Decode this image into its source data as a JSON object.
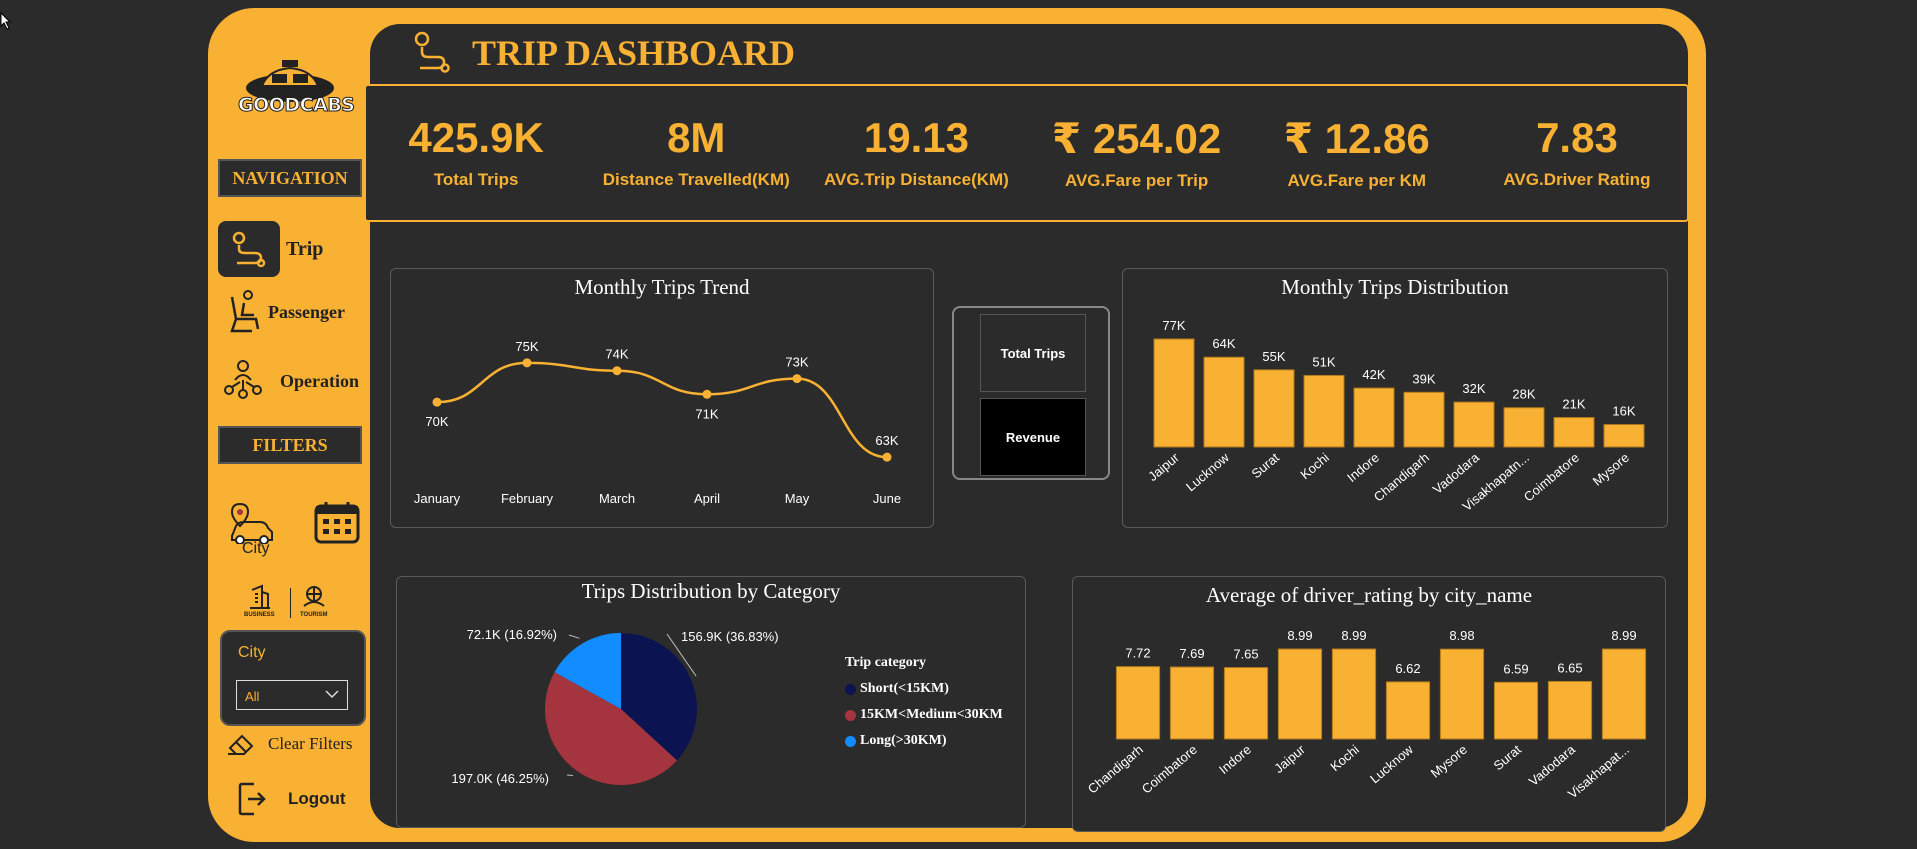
{
  "brand": {
    "logo_text": "GOODCABS"
  },
  "sidebar": {
    "navigation_title": "NAVIGATION",
    "nav_items": [
      {
        "label": "Trip",
        "active": true,
        "icon": "route-icon"
      },
      {
        "label": "Passenger",
        "active": false,
        "icon": "passenger-seat-icon"
      },
      {
        "label": "Operation",
        "active": false,
        "icon": "team-network-icon"
      }
    ],
    "filters_title": "FILTERS",
    "city_icon_label": "City",
    "business_label": "BUSINESS",
    "tourism_label": "TOURISM",
    "city_filter": {
      "label": "City",
      "value": "All"
    },
    "clear_filters": "Clear Filters",
    "logout": "Logout"
  },
  "header": {
    "title": "TRIP DASHBOARD"
  },
  "kpis": [
    {
      "value": "425.9K",
      "label": "Total Trips"
    },
    {
      "value": "8M",
      "label": "Distance Travelled(KM)"
    },
    {
      "value": "19.13",
      "label": "AVG.Trip Distance(KM)"
    },
    {
      "value": "₹ 254.02",
      "label": "AVG.Fare per Trip"
    },
    {
      "value": "₹ 12.86",
      "label": "AVG.Fare per KM"
    },
    {
      "value": "7.83",
      "label": "AVG.Driver Rating"
    }
  ],
  "toggle": {
    "option_1": "Total Trips",
    "option_2": "Revenue"
  },
  "colors": {
    "accent": "#f8b133",
    "panel": "#2b2b2b",
    "short": "#0b1451",
    "medium": "#a4343d",
    "long": "#118dff"
  },
  "chart_data": [
    {
      "type": "line",
      "title": "Monthly Trips Trend",
      "categories": [
        "January",
        "February",
        "March",
        "April",
        "May",
        "June"
      ],
      "values": [
        70,
        75,
        74,
        71,
        73,
        63
      ],
      "labels": [
        "70K",
        "75K",
        "74K",
        "71K",
        "73K",
        "63K"
      ],
      "grid": false
    },
    {
      "type": "bar",
      "title": "Monthly Trips Distribution",
      "categories": [
        "Jaipur",
        "Lucknow",
        "Surat",
        "Kochi",
        "Indore",
        "Chandigarh",
        "Vadodara",
        "Visakhapatn...",
        "Coimbatore",
        "Mysore"
      ],
      "values": [
        77,
        64,
        55,
        51,
        42,
        39,
        32,
        28,
        21,
        16
      ],
      "labels": [
        "77K",
        "64K",
        "55K",
        "51K",
        "42K",
        "39K",
        "32K",
        "28K",
        "21K",
        "16K"
      ],
      "grid": false
    },
    {
      "type": "pie",
      "title": "Trips Distribution by Category",
      "legend_title": "Trip category",
      "legend_position": "right",
      "slices": [
        {
          "name": "Short(<15KM)",
          "value": 156.9,
          "label": "156.9K (36.83%)"
        },
        {
          "name": "15KM<Medium<30KM",
          "value": 197.0,
          "label": "197.0K (46.25%)"
        },
        {
          "name": "Long(>30KM)",
          "value": 72.1,
          "label": "72.1K (16.92%)"
        }
      ]
    },
    {
      "type": "bar",
      "title": "Average of driver_rating by city_name",
      "categories": [
        "Chandigarh",
        "Coimbatore",
        "Indore",
        "Jaipur",
        "Kochi",
        "Lucknow",
        "Mysore",
        "Surat",
        "Vadodara",
        "Visakhapat..."
      ],
      "values": [
        7.72,
        7.69,
        7.65,
        8.99,
        8.99,
        6.62,
        8.98,
        6.59,
        6.65,
        8.99
      ],
      "labels": [
        "7.72",
        "7.69",
        "7.65",
        "8.99",
        "8.99",
        "6.62",
        "8.98",
        "6.59",
        "6.65",
        "8.99"
      ],
      "ylim": [
        0,
        10
      ],
      "grid": false
    }
  ]
}
